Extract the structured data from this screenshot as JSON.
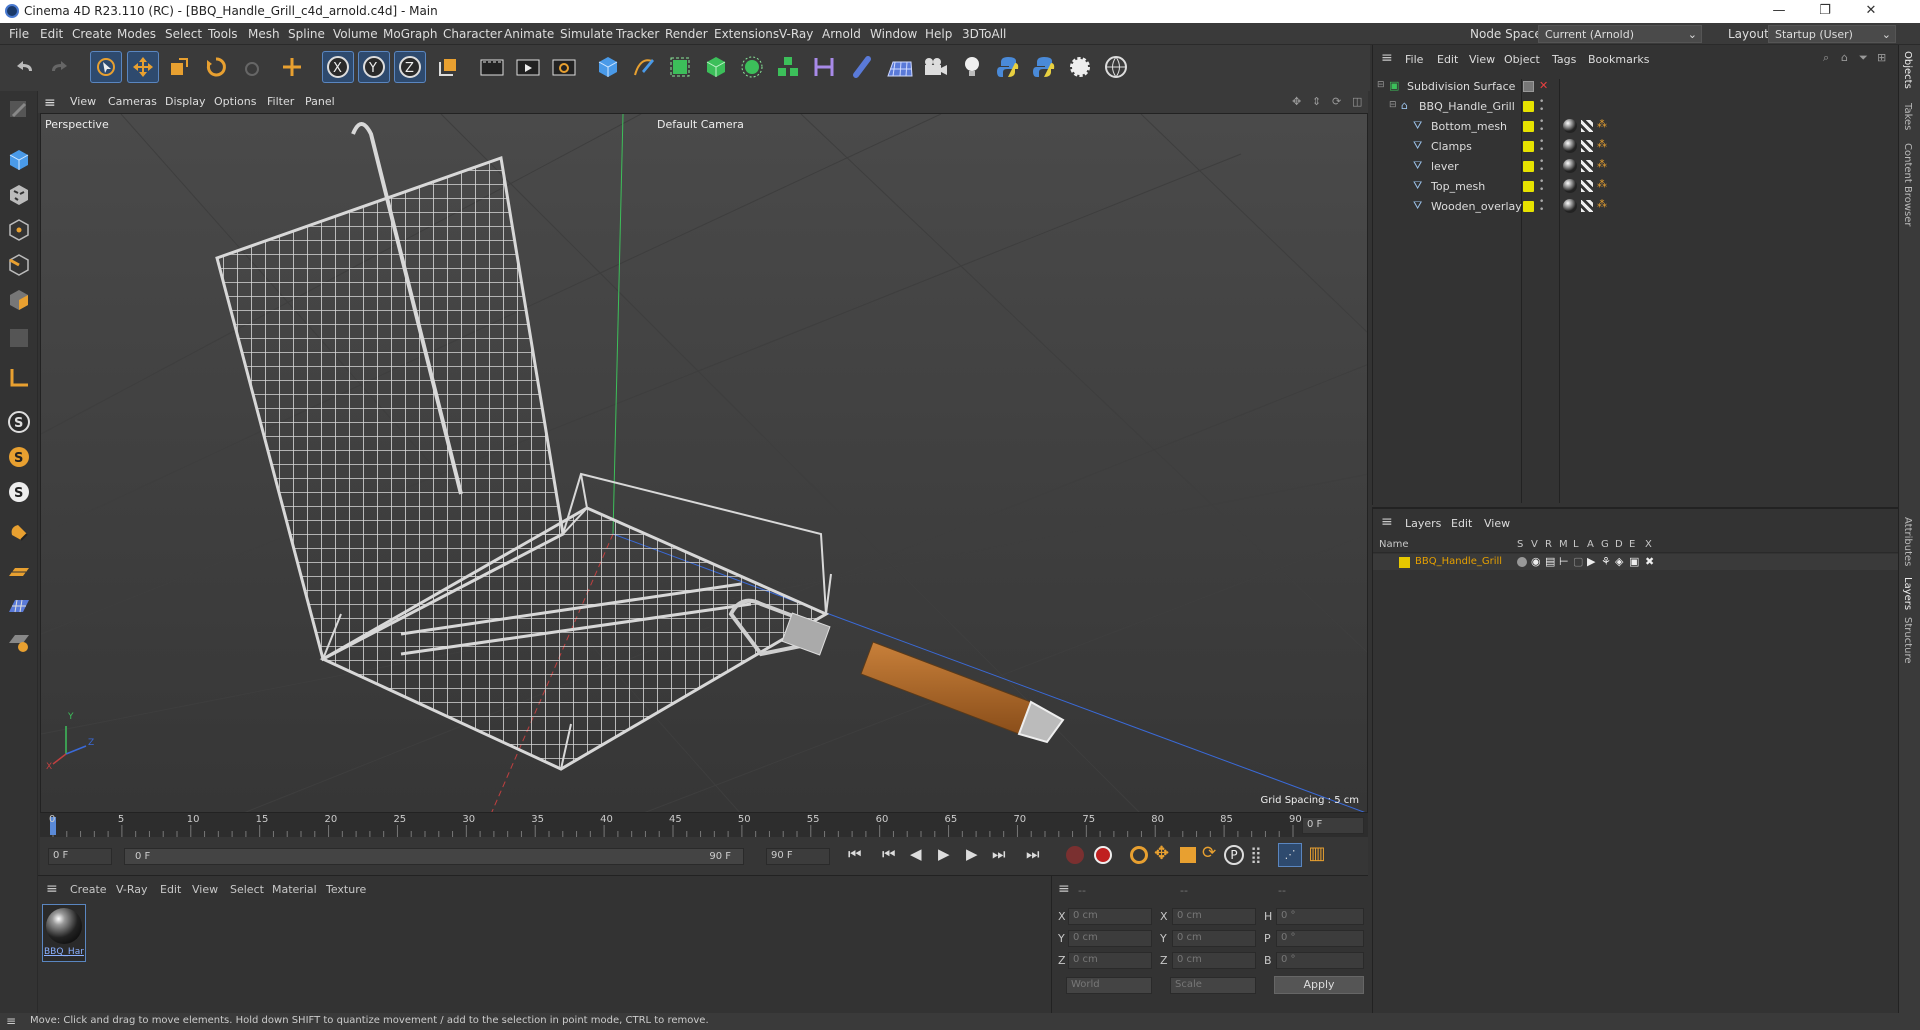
{
  "window": {
    "title": "Cinema 4D R23.110 (RC) - [BBQ_Handle_Grill_c4d_arnold.c4d] - Main",
    "controls": [
      "—",
      "❐",
      "✕"
    ]
  },
  "menu": [
    "File",
    "Edit",
    "Create",
    "Modes",
    "Select",
    "Tools",
    "Mesh",
    "Spline",
    "Volume",
    "MoGraph",
    "Character",
    "Animate",
    "Simulate",
    "Tracker",
    "Render",
    "Extensions",
    "V-Ray",
    "Arnold",
    "Window",
    "Help",
    "3DToAll"
  ],
  "node_space": {
    "label": "Node Space:",
    "value": "Current (Arnold)"
  },
  "layout": {
    "label": "Layout:",
    "value": "Startup (User)"
  },
  "viewport": {
    "menu": [
      "View",
      "Cameras",
      "Display",
      "Options",
      "Filter",
      "Panel"
    ],
    "label": "Perspective",
    "camera": "Default Camera",
    "grid_spacing": "Grid Spacing : 5 cm",
    "axis_x": "X",
    "axis_y": "Y",
    "axis_z": "Z"
  },
  "timeline": {
    "ticks": [
      "0",
      "5",
      "10",
      "15",
      "20",
      "25",
      "30",
      "35",
      "40",
      "45",
      "50",
      "55",
      "60",
      "65",
      "70",
      "75",
      "80",
      "85",
      "90"
    ],
    "current": "0 F"
  },
  "playback": {
    "start": "0 F",
    "range_start": "0 F",
    "range_end": "90 F",
    "end": "90 F"
  },
  "material_manager": {
    "menu": [
      "Create",
      "V-Ray",
      "Edit",
      "View",
      "Select",
      "Material",
      "Texture"
    ],
    "material_name": "BBQ_Har"
  },
  "attributes": {
    "labels": [
      "X",
      "Y",
      "Z",
      "X",
      "Y",
      "Z",
      "H",
      "P",
      "B"
    ],
    "dashes": [
      "--",
      "--",
      "--"
    ],
    "values_pos": [
      "0 cm",
      "0 cm",
      "0 cm"
    ],
    "values_size": [
      "0 cm",
      "0 cm",
      "0 cm"
    ],
    "values_rot": [
      "0 °",
      "0 °",
      "0 °"
    ],
    "coord_mode": "World",
    "size_mode": "Scale",
    "apply": "Apply"
  },
  "object_manager": {
    "menu": [
      "File",
      "Edit",
      "View",
      "Object",
      "Tags",
      "Bookmarks"
    ],
    "items": [
      "Subdivision Surface",
      "BBQ_Handle_Grill",
      "Bottom_mesh",
      "Clamps",
      "lever",
      "Top_mesh",
      "Wooden_overlay"
    ]
  },
  "layer_manager": {
    "menu": [
      "Layers",
      "Edit",
      "View"
    ],
    "columns": [
      "Name",
      "S",
      "V",
      "R",
      "M",
      "L",
      "A",
      "G",
      "D",
      "E",
      "X"
    ],
    "layer_name": "BBQ_Handle_Grill",
    "layer_color": "#e6c800"
  },
  "right_tabs": [
    "Objects",
    "Takes",
    "Content Browser",
    "Attributes",
    "Layers",
    "Structure"
  ],
  "status": "Move: Click and drag to move elements. Hold down SHIFT to quantize movement / add to the selection in point mode, CTRL to remove.",
  "colors": {
    "accent": "#2e4a6e",
    "selected_blue": "#5a86c0",
    "tag_yellow": "#e6e200",
    "layer_orange": "#e6a000"
  }
}
